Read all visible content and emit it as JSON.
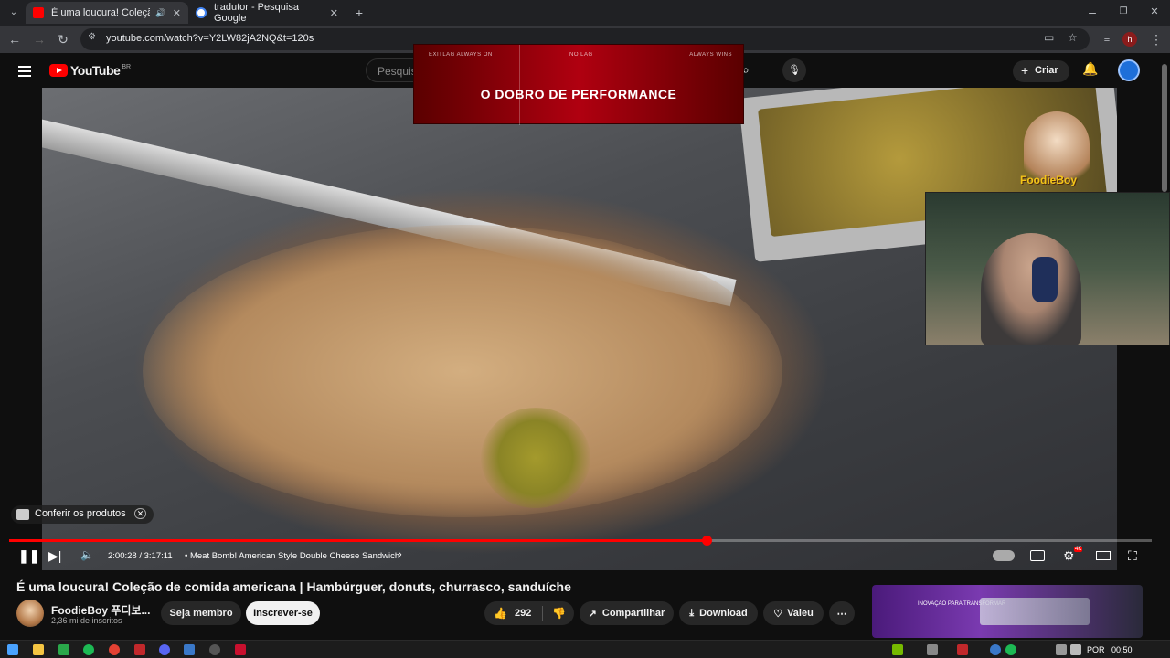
{
  "browser": {
    "tabs": [
      {
        "title": "É uma loucura! Coleção de",
        "active": true,
        "favicon_color": "#ff0000"
      },
      {
        "title": "tradutor - Pesquisa Google",
        "active": false,
        "favicon_color": "#4285f4"
      }
    ],
    "url": "youtube.com/watch?v=Y2LW82jA2NQ&t=120s",
    "profile_initial": "h"
  },
  "yt_header": {
    "logo_text": "YouTube",
    "country_code": "BR",
    "search_placeholder": "Pesquis",
    "create_label": "Criar"
  },
  "ad": {
    "tag_left": "EXITLAG ALWAYS ON",
    "tag_mid": "NO LAG",
    "tag_right": "ALWAYS WINS",
    "headline": "O DOBRO DE PERFORMANCE"
  },
  "overlay": {
    "channel_logo_text": "FoodieBoy",
    "products_label": "Conferir os produtos"
  },
  "player": {
    "time_current": "2:00:28",
    "time_total": "3:17:11",
    "timecode": "2:00:28 / 3:17:11",
    "chapter": "• Meat Bomb! American Style Double Cheese Sandwich",
    "progress_fraction": 0.61,
    "settings_badge": "4K"
  },
  "video": {
    "title": "É uma loucura! Coleção de comida americana | Hambúrguer, donuts, churrasco, sanduíche",
    "channel_name": "FoodieBoy 푸디보...",
    "subscribers": "2,36 mi de inscritos",
    "join_label": "Seja membro",
    "subscribe_label": "Inscrever-se",
    "likes": "292",
    "share_label": "Compartilhar",
    "download_label": "Download",
    "thanks_label": "Valeu"
  },
  "recommendation": {
    "caption": "INOVAÇÃO PARA TRANSFORMAR"
  },
  "taskbar": {
    "language": "POR",
    "time": "00:50"
  },
  "colors": {
    "accent": "#ff0000",
    "background": "#0f0f0f",
    "chrome_dark": "#202124",
    "chrome_mid": "#35363a"
  }
}
